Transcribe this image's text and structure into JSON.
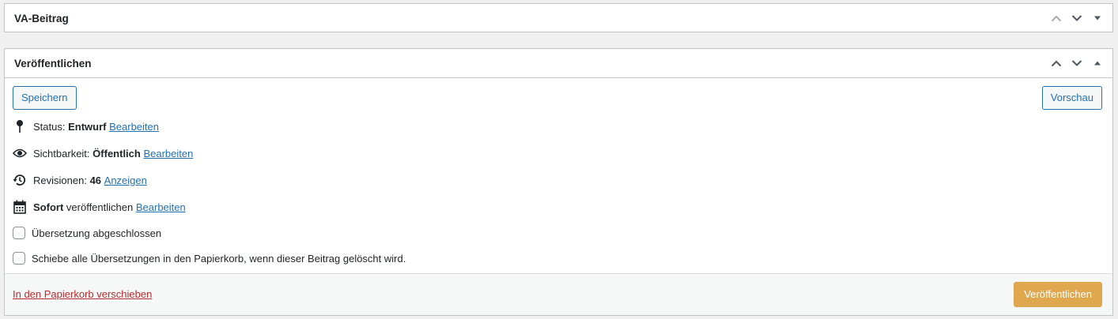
{
  "boxes": {
    "va": {
      "title": "VA-Beitrag"
    },
    "publish": {
      "title": "Veröffentlichen"
    }
  },
  "actions": {
    "save_label": "Speichern",
    "preview_label": "Vorschau",
    "trash_label": "In den Papierkorb verschieben",
    "publish_label": "Veröffentlichen"
  },
  "misc": {
    "status": {
      "label": "Status:",
      "value": "Entwurf",
      "link": "Bearbeiten"
    },
    "visibility": {
      "label": "Sichtbarkeit:",
      "value": "Öffentlich",
      "link": "Bearbeiten"
    },
    "revisions": {
      "label": "Revisionen:",
      "value": "46",
      "link": "Anzeigen"
    },
    "schedule": {
      "value": "Sofort",
      "label": "veröffentlichen",
      "link": "Bearbeiten"
    }
  },
  "checkboxes": {
    "translation_done": "Übersetzung abgeschlossen",
    "trash_translations": "Schiebe alle Übersetzungen in den Papierkorb, wenn dieser Beitrag gelöscht wird."
  },
  "icons": {
    "move_up": "chevron-up-icon",
    "move_down": "chevron-down-icon",
    "toggle_collapsed": "triangle-down-icon",
    "toggle_expanded": "triangle-up-icon",
    "status": "pin-icon",
    "visibility": "eye-icon",
    "revisions": "history-icon",
    "schedule": "calendar-icon"
  },
  "colors": {
    "link": "#2271b1",
    "delete_link": "#b32d2e",
    "publish_button": "#e0a84e"
  }
}
